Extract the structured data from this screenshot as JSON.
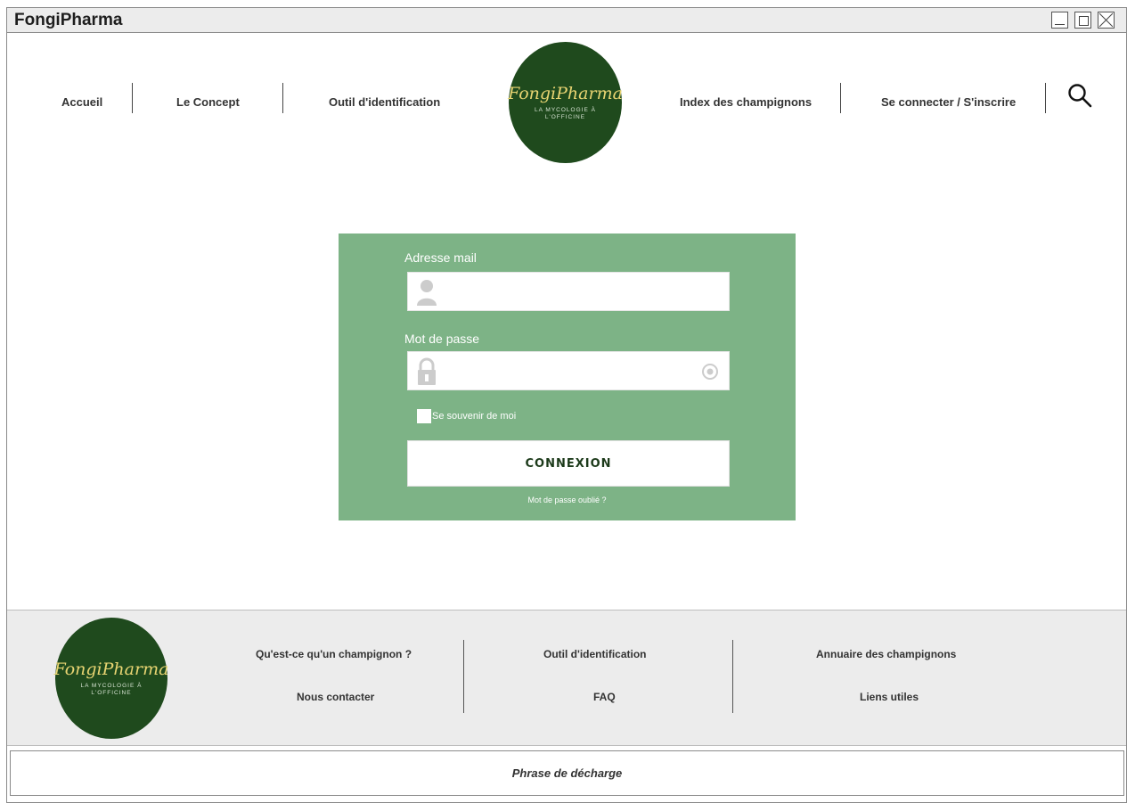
{
  "window": {
    "title": "FongiPharma"
  },
  "nav": {
    "accueil": "Accueil",
    "concept": "Le Concept",
    "outil": "Outil d'identification",
    "index": "Index des champignons",
    "connect": "Se connecter / S'inscrire"
  },
  "logo": {
    "name": "FongiPharma",
    "tagline_line1": "LA MYCOLOGIE À",
    "tagline_line2": "L'OFFICINE"
  },
  "login": {
    "email_label": "Adresse mail",
    "email_value": "",
    "password_label": "Mot de passe",
    "password_value": "",
    "remember_label": "Se souvenir de moi",
    "remember_checked": false,
    "submit_label": "CONNEXION",
    "forgot_label": "Mot de passe oublié ?"
  },
  "footer": {
    "col1": [
      "Qu'est-ce qu'un champignon ?",
      "Nous contacter"
    ],
    "col2": [
      "Outil d'identification",
      "FAQ"
    ],
    "col3": [
      "Annuaire des champignons",
      "Liens utiles"
    ],
    "disclaimer": "Phrase de décharge"
  },
  "colors": {
    "brand_green": "#1f4a1d",
    "panel_green": "#7db386",
    "logo_gold": "#e8d472"
  }
}
